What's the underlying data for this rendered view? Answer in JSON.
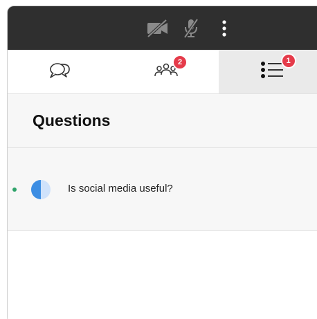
{
  "colors": {
    "control_bar": "#2f2f2f",
    "badge": "#e53b4a",
    "status_dot": "#2ea36a",
    "progress_fill": "#3d8ee3",
    "progress_track": "#cfe2fb"
  },
  "controls": {
    "icons": [
      "video-off-icon",
      "mic-off-icon",
      "more-vertical-icon"
    ]
  },
  "tabs": [
    {
      "icon": "chat-bubbles-icon",
      "badge": ""
    },
    {
      "icon": "participants-icon",
      "badge": "2"
    },
    {
      "icon": "questions-list-icon",
      "badge": "1",
      "active": true
    }
  ],
  "header": {
    "title": "Questions"
  },
  "questions": [
    {
      "text": "Is social media useful?",
      "progress": 0.5,
      "status": "active"
    }
  ]
}
